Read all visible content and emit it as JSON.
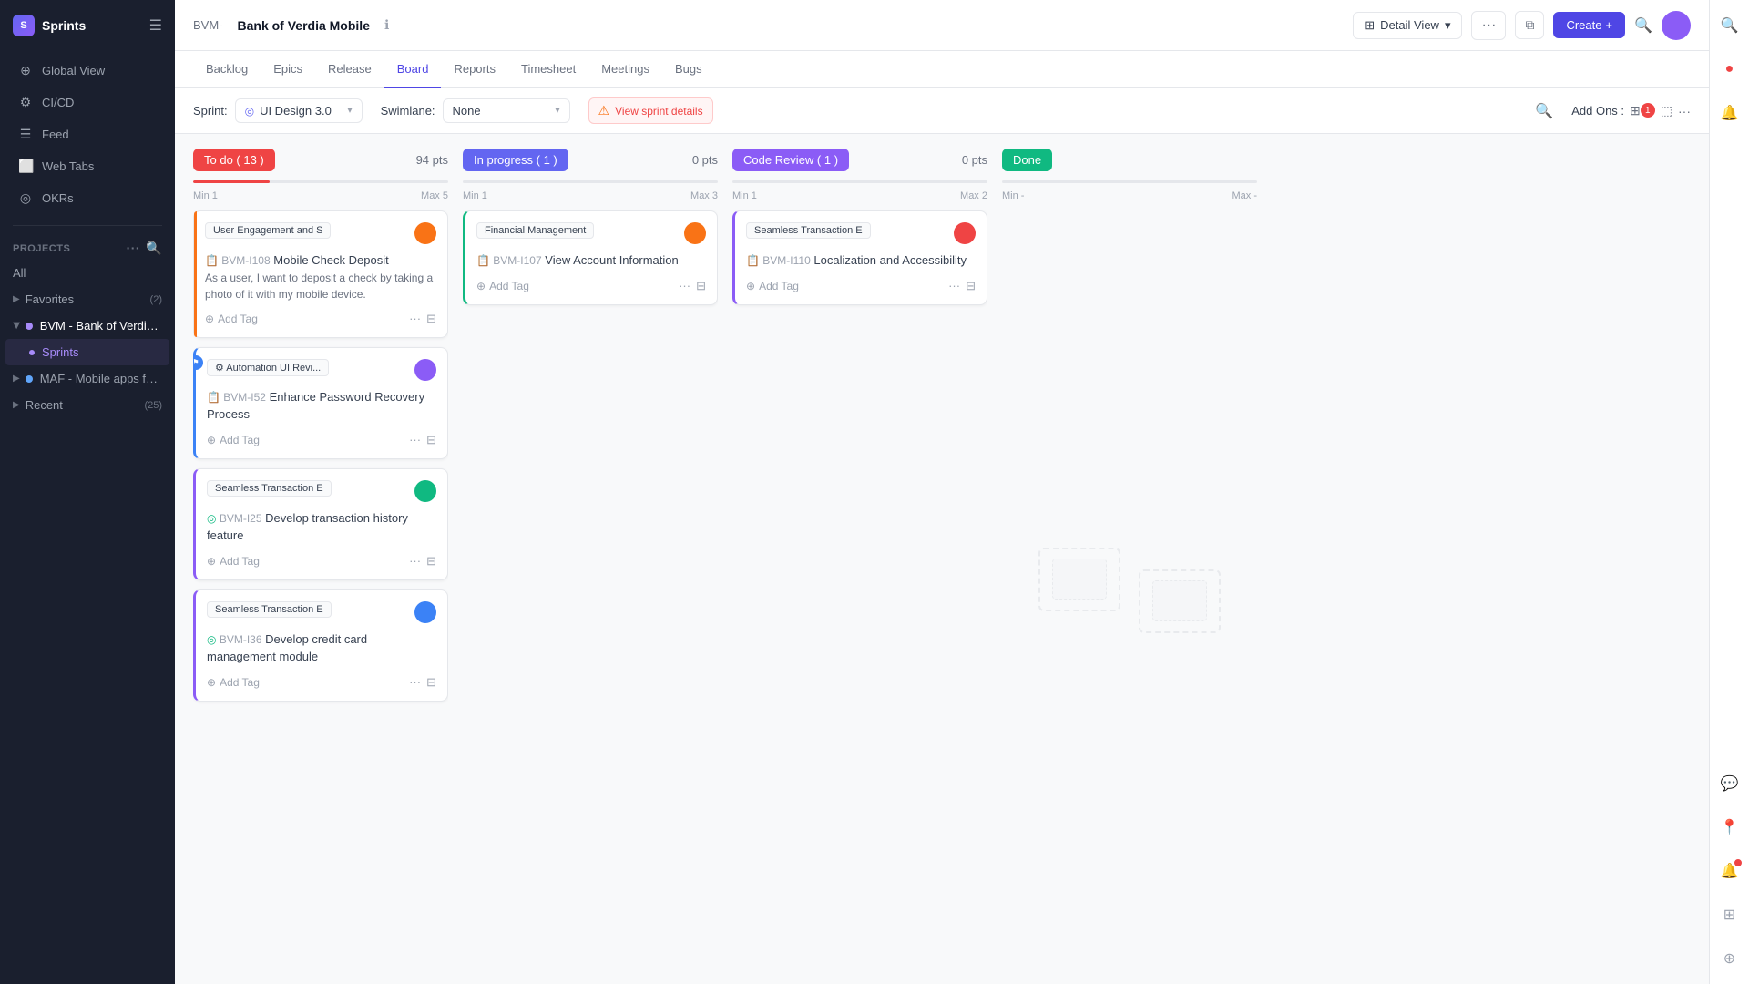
{
  "sidebar": {
    "brand": "Sprints",
    "nav_items": [
      {
        "id": "global-view",
        "label": "Global View",
        "icon": "⊕"
      },
      {
        "id": "cicd",
        "label": "CI/CD",
        "icon": "⚙"
      },
      {
        "id": "feed",
        "label": "Feed",
        "icon": "☰"
      },
      {
        "id": "web-tabs",
        "label": "Web Tabs",
        "icon": "⬜"
      },
      {
        "id": "okrs",
        "label": "OKRs",
        "icon": "◎"
      }
    ],
    "projects_section": "PROJECTS",
    "projects": [
      {
        "id": "all",
        "label": "All",
        "color": null
      },
      {
        "id": "favorites",
        "label": "Favorites",
        "count": "(2)",
        "color": null,
        "expanded": false
      },
      {
        "id": "bvm",
        "label": "BVM - Bank of Verdia...",
        "color": "#a78bfa",
        "active": true
      },
      {
        "id": "maf",
        "label": "MAF - Mobile apps fo...",
        "color": "#60a5fa"
      },
      {
        "id": "recent",
        "label": "Recent",
        "count": "(25)",
        "color": null
      }
    ]
  },
  "topbar": {
    "prefix": "BVM-",
    "title": "Bank of Verdia Mobile",
    "detail_view_label": "Detail View",
    "create_label": "Create"
  },
  "tabs": [
    {
      "id": "backlog",
      "label": "Backlog"
    },
    {
      "id": "epics",
      "label": "Epics"
    },
    {
      "id": "release",
      "label": "Release"
    },
    {
      "id": "board",
      "label": "Board",
      "active": true
    },
    {
      "id": "reports",
      "label": "Reports"
    },
    {
      "id": "timesheet",
      "label": "Timesheet"
    },
    {
      "id": "meetings",
      "label": "Meetings"
    },
    {
      "id": "bugs",
      "label": "Bugs"
    }
  ],
  "toolbar": {
    "sprint_label": "Sprint:",
    "sprint_value": "UI Design 3.0",
    "swimlane_label": "Swimlane:",
    "swimlane_value": "None",
    "view_sprint_details": "View sprint details",
    "add_ons_label": "Add Ons :",
    "add_ons_badge": "1"
  },
  "columns": [
    {
      "id": "todo",
      "badge": "To do ( 13 )",
      "badge_class": "todo",
      "pts": "94 pts",
      "min": "Min 1",
      "max": "Max 5",
      "progress": 30,
      "progress_color": "#ef4444",
      "cards": [
        {
          "id": "c1",
          "epic": "User Engagement and S",
          "task_id": "BVM-I108",
          "task_type": "story",
          "title": "Mobile Check Deposit",
          "description": "As a user, I want to deposit a check by taking a photo of it with my mobile device.",
          "left_color": "orange",
          "avatar_color": "av-orange"
        },
        {
          "id": "c2",
          "epic": "Automation UI Revi...",
          "epic_icon": "⚙",
          "task_id": "BVM-I52",
          "task_type": "task",
          "title": "Enhance Password Recovery Process",
          "description": null,
          "left_color": "blue",
          "avatar_color": "av-purple",
          "has_flag": true
        },
        {
          "id": "c3",
          "epic": "Seamless Transaction E",
          "task_id": "BVM-I25",
          "task_type": "story",
          "title": "Develop transaction history feature",
          "description": null,
          "left_color": "purple",
          "avatar_color": "av-green"
        },
        {
          "id": "c4",
          "epic": "Seamless Transaction E",
          "task_id": "BVM-I36",
          "task_type": "story",
          "title": "Develop credit card management module",
          "description": null,
          "left_color": "purple",
          "avatar_color": "av-blue"
        }
      ]
    },
    {
      "id": "inprogress",
      "badge": "In progress ( 1 )",
      "badge_class": "inprogress",
      "pts": "0 pts",
      "min": "Min 1",
      "max": "Max 3",
      "progress": 0,
      "progress_color": "#6366f1",
      "cards": [
        {
          "id": "c5",
          "epic": "Financial Management",
          "task_id": "BVM-I107",
          "task_type": "task",
          "title": "View Account Information",
          "description": null,
          "left_color": "green",
          "avatar_color": "av-orange"
        }
      ]
    },
    {
      "id": "codereview",
      "badge": "Code Review ( 1 )",
      "badge_class": "codereview",
      "pts": "0 pts",
      "min": "Min 1",
      "max": "Max 2",
      "progress": 0,
      "progress_color": "#8b5cf6",
      "cards": [
        {
          "id": "c6",
          "epic": "Seamless Transaction E",
          "task_id": "BVM-I110",
          "task_type": "task",
          "title": "Localization and Accessibility",
          "description": null,
          "left_color": "purple",
          "avatar_color": "av-red"
        }
      ]
    },
    {
      "id": "done",
      "badge": "Done",
      "badge_class": "done",
      "pts": "",
      "min": "Min -",
      "max": "Max -",
      "progress": 0,
      "progress_color": "#10b981",
      "cards": []
    }
  ]
}
